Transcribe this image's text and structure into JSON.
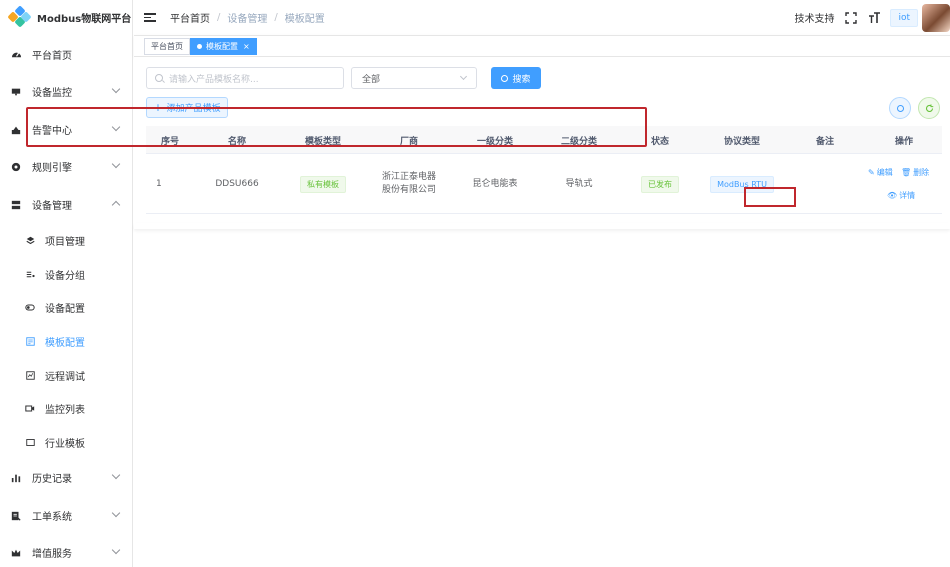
{
  "app": {
    "title": "Modbus物联网平台"
  },
  "sidebar": {
    "items": [
      {
        "label": "平台首页",
        "icon": "dashboard-icon",
        "expand": "none"
      },
      {
        "label": "设备监控",
        "icon": "monitor-icon",
        "expand": "down"
      },
      {
        "label": "告警中心",
        "icon": "alarm-icon",
        "expand": "down"
      },
      {
        "label": "规则引擎",
        "icon": "rule-engine-icon",
        "expand": "down"
      },
      {
        "label": "设备管理",
        "icon": "device-management-icon",
        "expand": "up"
      }
    ],
    "sub_items": [
      {
        "label": "项目管理",
        "icon": "layers-icon",
        "active": false
      },
      {
        "label": "设备分组",
        "icon": "group-list-icon",
        "active": false
      },
      {
        "label": "设备配置",
        "icon": "toggle-icon",
        "active": false
      },
      {
        "label": "模板配置",
        "icon": "template-icon",
        "active": true
      },
      {
        "label": "远程调试",
        "icon": "debug-icon",
        "active": false
      },
      {
        "label": "监控列表",
        "icon": "video-icon",
        "active": false
      },
      {
        "label": "行业模板",
        "icon": "frame-icon",
        "active": false
      }
    ],
    "bottom_items": [
      {
        "label": "历史记录",
        "icon": "bar-chart-icon"
      },
      {
        "label": "工单系统",
        "icon": "ticket-icon"
      },
      {
        "label": "增值服务",
        "icon": "crown-icon"
      }
    ]
  },
  "header": {
    "breadcrumb": [
      "平台首页",
      "设备管理",
      "模板配置"
    ],
    "tech_support": "技术支持",
    "user": "iot"
  },
  "tags": [
    {
      "label": "平台首页",
      "active": false
    },
    {
      "label": "模板配置",
      "active": true,
      "close": "×"
    }
  ],
  "toolbar": {
    "search_placeholder": "请输入产品模板名称...",
    "select_value": "全部",
    "search_label": "搜索",
    "add_label": "添加产品模板"
  },
  "table": {
    "columns": [
      "序号",
      "名称",
      "模板类型",
      "厂商",
      "一级分类",
      "二级分类",
      "状态",
      "协议类型",
      "备注",
      "操作"
    ],
    "rows": [
      {
        "index": "1",
        "name": "DDSU666",
        "template_type": "私有模板",
        "vendor": "浙江正泰电器股份有限公司",
        "category1": "昆仑电能表",
        "category2": "导轨式",
        "status": "已发布",
        "protocol": "ModBus RTU",
        "remark": "",
        "op_edit": "编辑",
        "op_delete": "删除",
        "op_detail": "详情"
      }
    ]
  },
  "colors": {
    "primary": "#409eff",
    "success": "#67c23a",
    "highlight": "#c0272d"
  }
}
